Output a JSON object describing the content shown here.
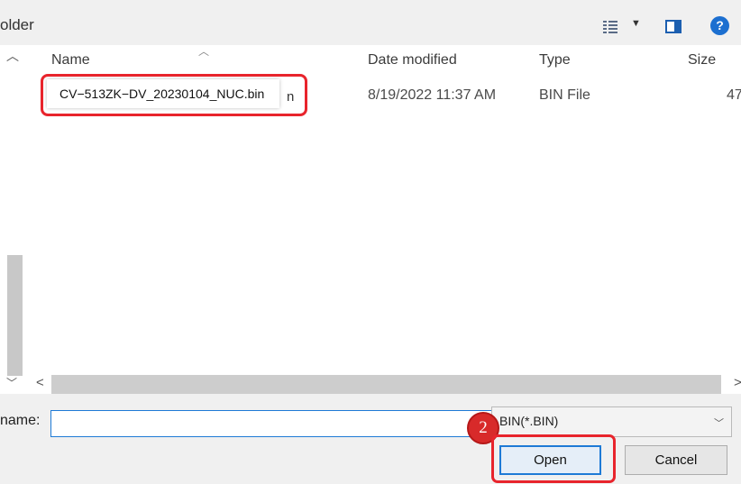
{
  "toolbar": {
    "title": "older"
  },
  "columns": {
    "name": "Name",
    "date": "Date modified",
    "type": "Type",
    "size": "Size"
  },
  "files": [
    {
      "name": "CV−513ZK−DV_20230104_NUC.bin",
      "name_trailing": "n",
      "date": "8/19/2022 11:37 AM",
      "type": "BIN File",
      "size": "47"
    }
  ],
  "footer": {
    "file_name_label": "name:",
    "file_name_value": "",
    "file_type_selected": "BIN(*.BIN)",
    "open_label": "Open",
    "cancel_label": "Cancel"
  },
  "annotation": {
    "step_number": "2",
    "highlight_color": "#e8242c"
  },
  "icons": {
    "view": "view-options-icon",
    "pane": "preview-pane-icon",
    "help": "help-icon"
  }
}
